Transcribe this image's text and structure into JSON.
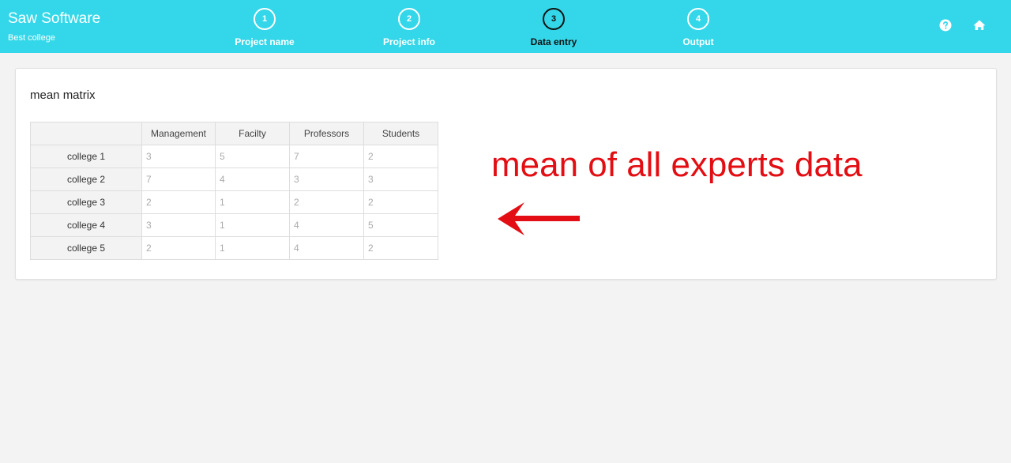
{
  "header": {
    "title": "Saw Software",
    "subtitle": "Best college",
    "steps": [
      {
        "number": "1",
        "label": "Project name"
      },
      {
        "number": "2",
        "label": "Project info"
      },
      {
        "number": "3",
        "label": "Data entry"
      },
      {
        "number": "4",
        "label": "Output"
      }
    ],
    "active_step": "Data entry",
    "icons": [
      "help-icon",
      "home-icon"
    ],
    "colors": {
      "bar": "#33d7e9",
      "active": "#111111"
    }
  },
  "panel": {
    "title": "mean matrix",
    "table": {
      "columns": [
        "Management",
        "Facilty",
        "Professors",
        "Students"
      ],
      "rows": [
        {
          "label": "college 1",
          "values": [
            "3",
            "5",
            "7",
            "2"
          ]
        },
        {
          "label": "college 2",
          "values": [
            "7",
            "4",
            "3",
            "3"
          ]
        },
        {
          "label": "college 3",
          "values": [
            "2",
            "1",
            "2",
            "2"
          ]
        },
        {
          "label": "college 4",
          "values": [
            "3",
            "1",
            "4",
            "5"
          ]
        },
        {
          "label": "college 5",
          "values": [
            "2",
            "1",
            "4",
            "2"
          ]
        }
      ]
    }
  },
  "annotation": {
    "text": "mean of all experts data",
    "color": "#e30e13",
    "icon": "left-arrow-icon"
  }
}
